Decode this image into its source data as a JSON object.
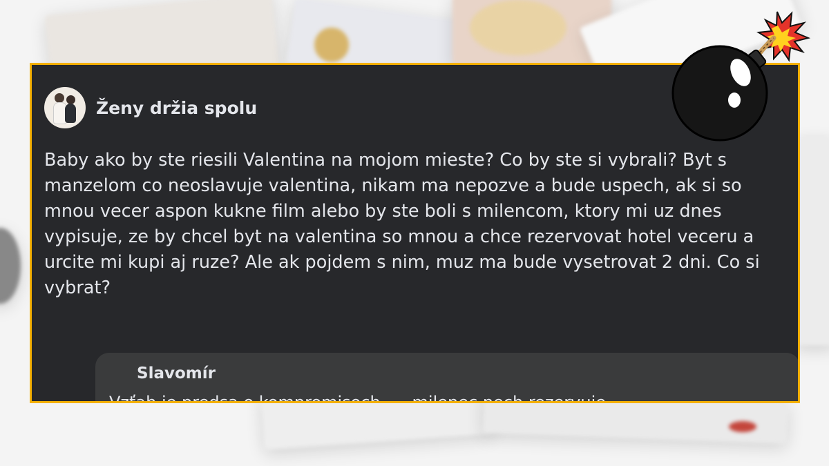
{
  "post": {
    "group_name": "Ženy držia spolu",
    "text": "Baby ako by ste riesili Valentina na mojom mieste? Co by ste si vybrali? Byt s manzelom co neoslavuje valentina, nikam ma nepozve a bude uspech, ak si so mnou vecer aspon kukne film alebo by ste boli s milencom, ktory mi uz dnes vypisuje, ze by chcel byt na valentina so mnou a chce rezervovat hotel veceru a urcite mi kupi aj ruze? Ale ak pojdem s nim, muz ma bude vysetrovat 2 dni. Co si vybrat?"
  },
  "comment": {
    "author": "Slavomír",
    "text": "Vzťah je predsa o kompromisoch..... milenec nech rezervuje"
  },
  "icons": {
    "group_avatar": "couple-photo-avatar",
    "decoration": "bomb-icon"
  },
  "colors": {
    "panel_background": "#27282b",
    "panel_border": "#f4b000",
    "comment_background": "#3a3b3c",
    "text": "#e4e6eb"
  }
}
